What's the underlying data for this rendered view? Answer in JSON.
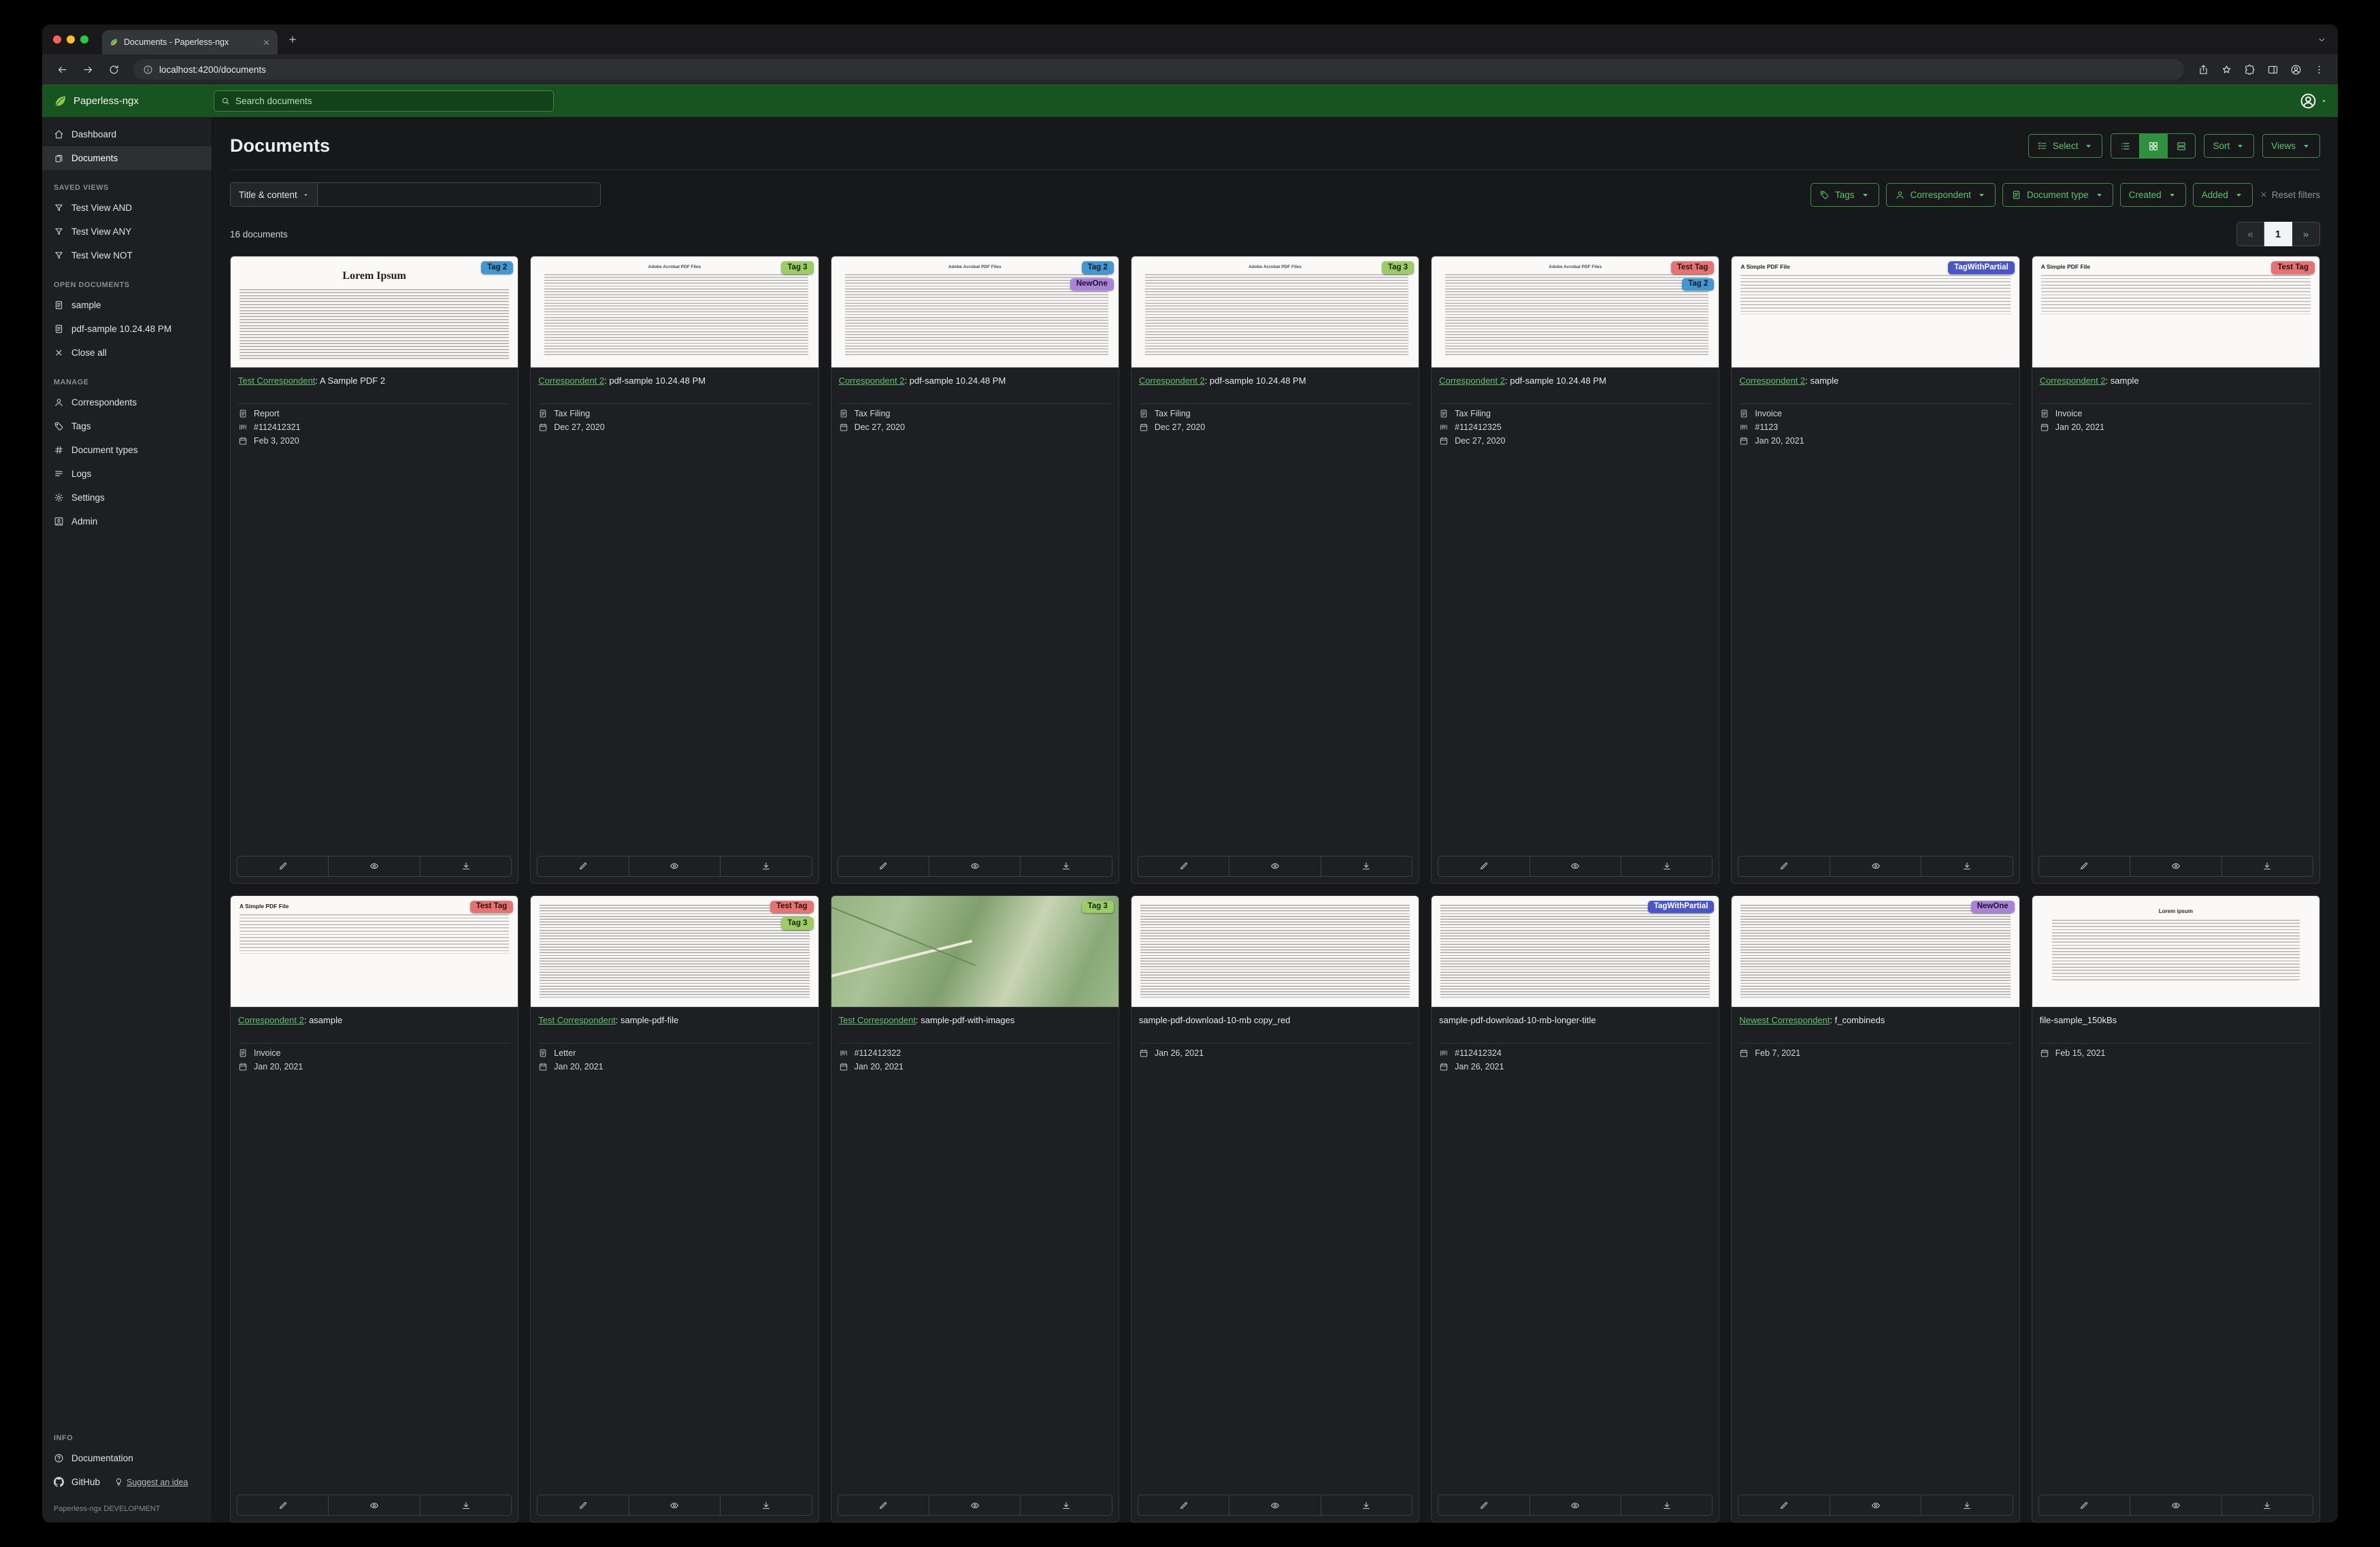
{
  "browser": {
    "tab_title": "Documents - Paperless-ngx",
    "url": "localhost:4200/documents"
  },
  "app_header": {
    "app_name": "Paperless-ngx",
    "search_placeholder": "Search documents"
  },
  "sidebar": {
    "primary": [
      {
        "label": "Dashboard",
        "icon": "i-house",
        "active": false
      },
      {
        "label": "Documents",
        "icon": "i-files",
        "active": true
      }
    ],
    "sections": {
      "saved_views": {
        "heading": "SAVED VIEWS",
        "items": [
          {
            "label": "Test View AND",
            "icon": "i-funnel"
          },
          {
            "label": "Test View ANY",
            "icon": "i-funnel"
          },
          {
            "label": "Test View NOT",
            "icon": "i-funnel"
          }
        ]
      },
      "open_documents": {
        "heading": "OPEN DOCUMENTS",
        "items": [
          {
            "label": "sample",
            "icon": "i-filetext"
          },
          {
            "label": "pdf-sample 10.24.48 PM",
            "icon": "i-filetext"
          },
          {
            "label": "Close all",
            "icon": "i-x"
          }
        ]
      },
      "manage": {
        "heading": "MANAGE",
        "items": [
          {
            "label": "Correspondents",
            "icon": "i-person"
          },
          {
            "label": "Tags",
            "icon": "i-tag"
          },
          {
            "label": "Document types",
            "icon": "i-hash"
          },
          {
            "label": "Logs",
            "icon": "i-list"
          },
          {
            "label": "Settings",
            "icon": "i-gear"
          },
          {
            "label": "Admin",
            "icon": "i-admin"
          }
        ]
      },
      "info": {
        "heading": "INFO",
        "items": [
          {
            "label": "Documentation",
            "icon": "i-question"
          },
          {
            "label": "GitHub",
            "icon": "i-github",
            "extra": "Suggest an idea",
            "extra_icon": "i-bulb"
          }
        ]
      }
    },
    "footer": "Paperless-ngx DEVELOPMENT"
  },
  "toolbar": {
    "title": "Documents",
    "select_label": "Select",
    "sort_label": "Sort",
    "views_label": "Views"
  },
  "filters": {
    "title_content_label": "Title & content",
    "query_value": "",
    "tags_label": "Tags",
    "correspondent_label": "Correspondent",
    "document_type_label": "Document type",
    "created_label": "Created",
    "added_label": "Added",
    "reset_label": "Reset filters"
  },
  "results": {
    "count_text": "16 documents",
    "pagination": {
      "prev": "«",
      "page": "1",
      "next": "»"
    }
  },
  "tag_colors": {
    "Tag 2": {
      "bg": "#4296d2",
      "fg": "#15191d"
    },
    "Tag 3": {
      "bg": "#9ccc65",
      "fg": "#1a2413"
    },
    "NewOne": {
      "bg": "#a983d9",
      "fg": "#1d1426"
    },
    "Test Tag": {
      "bg": "#e57373",
      "fg": "#2a1111"
    },
    "TagWithPartial": {
      "bg": "#4a55c7",
      "fg": "#ffffff"
    }
  },
  "documents": [
    {
      "tags": [
        "Tag 2"
      ],
      "correspondent": "Test Correspondent",
      "title": ": A Sample PDF 2",
      "type": "Report",
      "asn": "#112412321",
      "date": "Feb 3, 2020",
      "thumb_variant": "lorem",
      "thumb_title": "Lorem Ipsum"
    },
    {
      "tags": [
        "Tag 3"
      ],
      "correspondent": "Correspondent 2",
      "title": ": pdf-sample 10.24.48 PM",
      "type": "Tax Filing",
      "asn": "",
      "date": "Dec 27, 2020",
      "thumb_variant": "acrobat",
      "thumb_title": "Adobe Acrobat PDF Files"
    },
    {
      "tags": [
        "Tag 2",
        "NewOne"
      ],
      "correspondent": "Correspondent 2",
      "title": ": pdf-sample 10.24.48 PM",
      "type": "Tax Filing",
      "asn": "",
      "date": "Dec 27, 2020",
      "thumb_variant": "acrobat",
      "thumb_title": "Adobe Acrobat PDF Files"
    },
    {
      "tags": [
        "Tag 3"
      ],
      "correspondent": "Correspondent 2",
      "title": ": pdf-sample 10.24.48 PM",
      "type": "Tax Filing",
      "asn": "",
      "date": "Dec 27, 2020",
      "thumb_variant": "acrobat",
      "thumb_title": "Adobe Acrobat PDF Files"
    },
    {
      "tags": [
        "Test Tag",
        "Tag 2"
      ],
      "correspondent": "Correspondent 2",
      "title": ": pdf-sample 10.24.48 PM",
      "type": "Tax Filing",
      "asn": "#112412325",
      "date": "Dec 27, 2020",
      "thumb_variant": "acrobat",
      "thumb_title": "Adobe Acrobat PDF Files"
    },
    {
      "tags": [
        "TagWithPartial"
      ],
      "correspondent": "Correspondent 2",
      "title": ": sample",
      "type": "Invoice",
      "asn": "#1123",
      "date": "Jan 20, 2021",
      "thumb_variant": "simple",
      "thumb_title": "A Simple PDF File"
    },
    {
      "tags": [
        "Test Tag"
      ],
      "correspondent": "Correspondent 2",
      "title": ": sample",
      "type": "Invoice",
      "asn": "",
      "date": "Jan 20, 2021",
      "thumb_variant": "simple",
      "thumb_title": "A Simple PDF File"
    },
    {
      "tags": [
        "Test Tag"
      ],
      "correspondent": "Correspondent 2",
      "title": ": asample",
      "type": "Invoice",
      "asn": "",
      "date": "Jan 20, 2021",
      "thumb_variant": "simple",
      "thumb_title": "A Simple PDF File"
    },
    {
      "tags": [
        "Test Tag",
        "Tag 3"
      ],
      "correspondent": "Test Correspondent",
      "title": ": sample-pdf-file",
      "type": "Letter",
      "asn": "",
      "date": "Jan 20, 2021",
      "thumb_variant": "dense",
      "thumb_title": ""
    },
    {
      "tags": [
        "Tag 3"
      ],
      "correspondent": "Test Correspondent",
      "title": ": sample-pdf-with-images",
      "type": "",
      "asn": "#112412322",
      "date": "Jan 20, 2021",
      "thumb_variant": "map",
      "thumb_title": ""
    },
    {
      "tags": [],
      "correspondent": "",
      "title": "sample-pdf-download-10-mb copy_red",
      "type": "",
      "asn": "",
      "date": "Jan 26, 2021",
      "thumb_variant": "dense",
      "thumb_title": ""
    },
    {
      "tags": [
        "TagWithPartial"
      ],
      "correspondent": "",
      "title": "sample-pdf-download-10-mb-longer-title",
      "type": "",
      "asn": "#112412324",
      "date": "Jan 26, 2021",
      "thumb_variant": "dense",
      "thumb_title": ""
    },
    {
      "tags": [
        "NewOne"
      ],
      "correspondent": "Newest Correspondent",
      "title": ": f_combineds",
      "type": "",
      "asn": "",
      "date": "Feb 7, 2021",
      "thumb_variant": "dense",
      "thumb_title": ""
    },
    {
      "tags": [],
      "correspondent": "",
      "title": "file-sample_150kBs",
      "type": "",
      "asn": "",
      "date": "Feb 15, 2021",
      "thumb_variant": "center",
      "thumb_title": "Lorem ipsum"
    }
  ]
}
